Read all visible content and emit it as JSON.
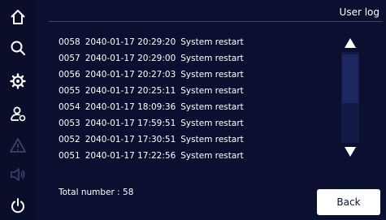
{
  "screen": {
    "title": "User log"
  },
  "sidebar": {
    "items": [
      {
        "name": "home-icon",
        "enabled": true
      },
      {
        "name": "search-icon",
        "enabled": true
      },
      {
        "name": "gear-icon",
        "enabled": true
      },
      {
        "name": "user-settings-icon",
        "enabled": true
      },
      {
        "name": "warning-icon",
        "enabled": false
      },
      {
        "name": "speaker-icon",
        "enabled": false
      },
      {
        "name": "power-icon",
        "enabled": true
      }
    ]
  },
  "log": {
    "entries": [
      {
        "id": "0058",
        "datetime": "2040-01-17 20:29:20",
        "event": "System restart"
      },
      {
        "id": "0057",
        "datetime": "2040-01-17 20:29:00",
        "event": "System restart"
      },
      {
        "id": "0056",
        "datetime": "2040-01-17 20:27:03",
        "event": "System restart"
      },
      {
        "id": "0055",
        "datetime": "2040-01-17 20:25:11",
        "event": "System restart"
      },
      {
        "id": "0054",
        "datetime": "2040-01-17 18:09:36",
        "event": "System restart"
      },
      {
        "id": "0053",
        "datetime": "2040-01-17 17:59:51",
        "event": "System restart"
      },
      {
        "id": "0052",
        "datetime": "2040-01-17 17:30:51",
        "event": "System restart"
      },
      {
        "id": "0051",
        "datetime": "2040-01-17 17:22:56",
        "event": "System restart"
      }
    ],
    "total_text": "Total number : 58"
  },
  "buttons": {
    "back": "Back"
  },
  "colors": {
    "background": "#0b1030",
    "sidebar": "#0a0e28",
    "text": "#ffffff",
    "disabled_icon": "#3a4270"
  }
}
